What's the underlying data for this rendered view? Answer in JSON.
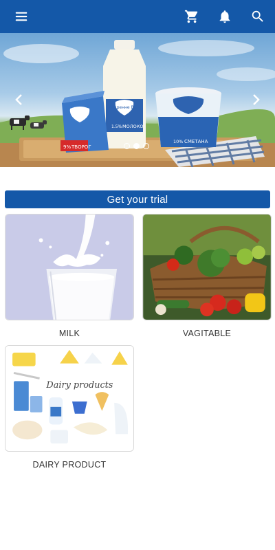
{
  "appbar": {
    "background": "#1458a8",
    "icons": [
      "menu-icon",
      "cart-icon",
      "bell-icon",
      "search-icon"
    ]
  },
  "banner": {
    "slide_count": 3,
    "active_slide": 2,
    "product_texts": {
      "brand": "Искренне Ваш",
      "milk_label": "МОЛОКО",
      "milk_fat": "1.5%",
      "tvorog_label": "ТВОРОГ",
      "tvorog_fat": "9%",
      "smetana_label": "СМЕТАНА",
      "smetana_fat": "10%"
    }
  },
  "trial": {
    "label": "Get your trial"
  },
  "categories": [
    {
      "label": "MILK"
    },
    {
      "label": "VAGITABLE"
    },
    {
      "label": "DAIRY PRODUCT",
      "image_text": "Dairy products"
    }
  ]
}
